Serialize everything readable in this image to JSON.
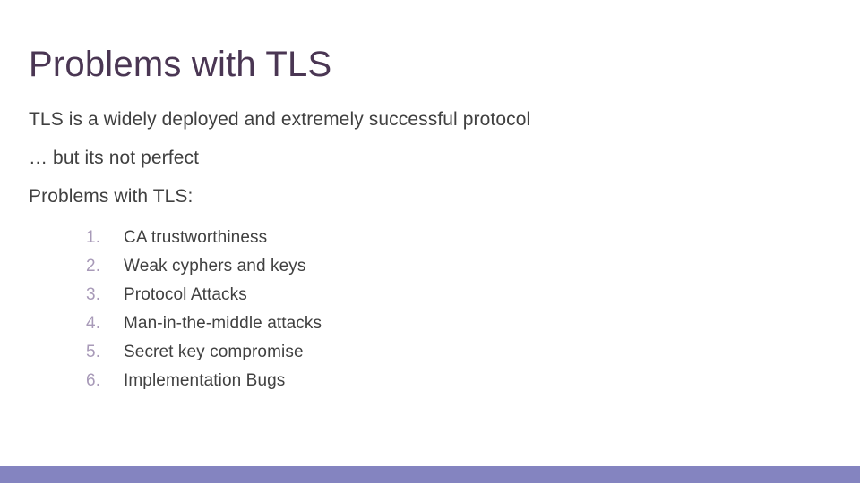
{
  "slide": {
    "title": "Problems with TLS",
    "body_lines": [
      "TLS is a widely deployed and extremely successful protocol",
      "… but its not perfect",
      "Problems with TLS:"
    ],
    "list": [
      {
        "number": "1.",
        "text": "CA trustworthiness"
      },
      {
        "number": "2.",
        "text": "Weak cyphers and keys"
      },
      {
        "number": "3.",
        "text": "Protocol Attacks"
      },
      {
        "number": "4.",
        "text": "Man-in-the-middle attacks"
      },
      {
        "number": "5.",
        "text": "Secret key compromise"
      },
      {
        "number": "6.",
        "text": "Implementation Bugs"
      }
    ],
    "colors": {
      "title": "#4a3653",
      "body_text": "#404040",
      "list_number": "#a89ab8",
      "footer_bar": "#8484c0",
      "background": "#ffffff"
    }
  }
}
